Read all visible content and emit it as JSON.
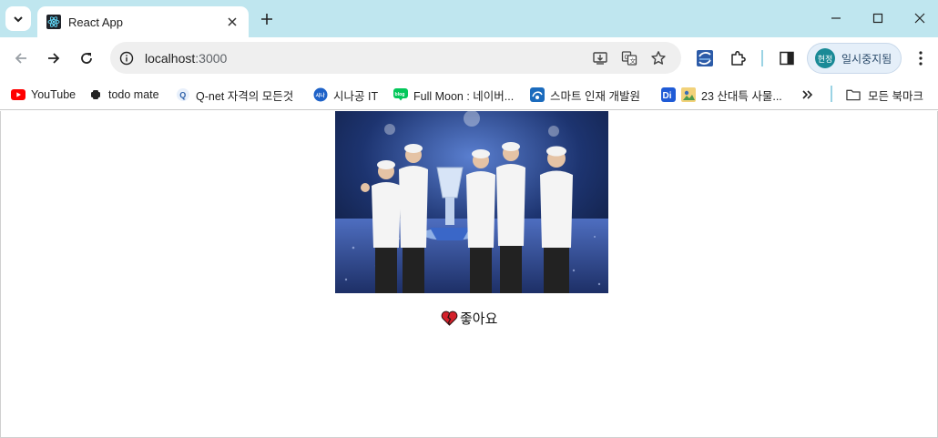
{
  "browser": {
    "tab": {
      "title": "React App"
    },
    "address": {
      "host": "localhost",
      "port": ":3000"
    },
    "profile": {
      "avatar_text": "현정",
      "label": "일시중지됨"
    },
    "bookmarks": [
      {
        "label": "YouTube",
        "icon": "youtube-icon"
      },
      {
        "label": "todo mate",
        "icon": "todo-mate-icon"
      },
      {
        "label": "Q-net 자격의 모든것",
        "icon": "qnet-icon"
      },
      {
        "label": "시나공 IT",
        "icon": "sinagong-icon"
      },
      {
        "label": "Full Moon : 네이버...",
        "icon": "naver-blog-icon"
      },
      {
        "label": "스마트 인재 개발원",
        "icon": "smart-institute-icon"
      },
      {
        "label": "",
        "icon": "di-icon"
      },
      {
        "label": "23 산대특 사물...",
        "icon": "folder-photo-icon"
      }
    ],
    "all_bookmarks_label": "모든 북마크",
    "accent_color": "#bfe6ef"
  },
  "page": {
    "like": {
      "icon": "broken-heart-icon",
      "label": "좋아요"
    }
  }
}
